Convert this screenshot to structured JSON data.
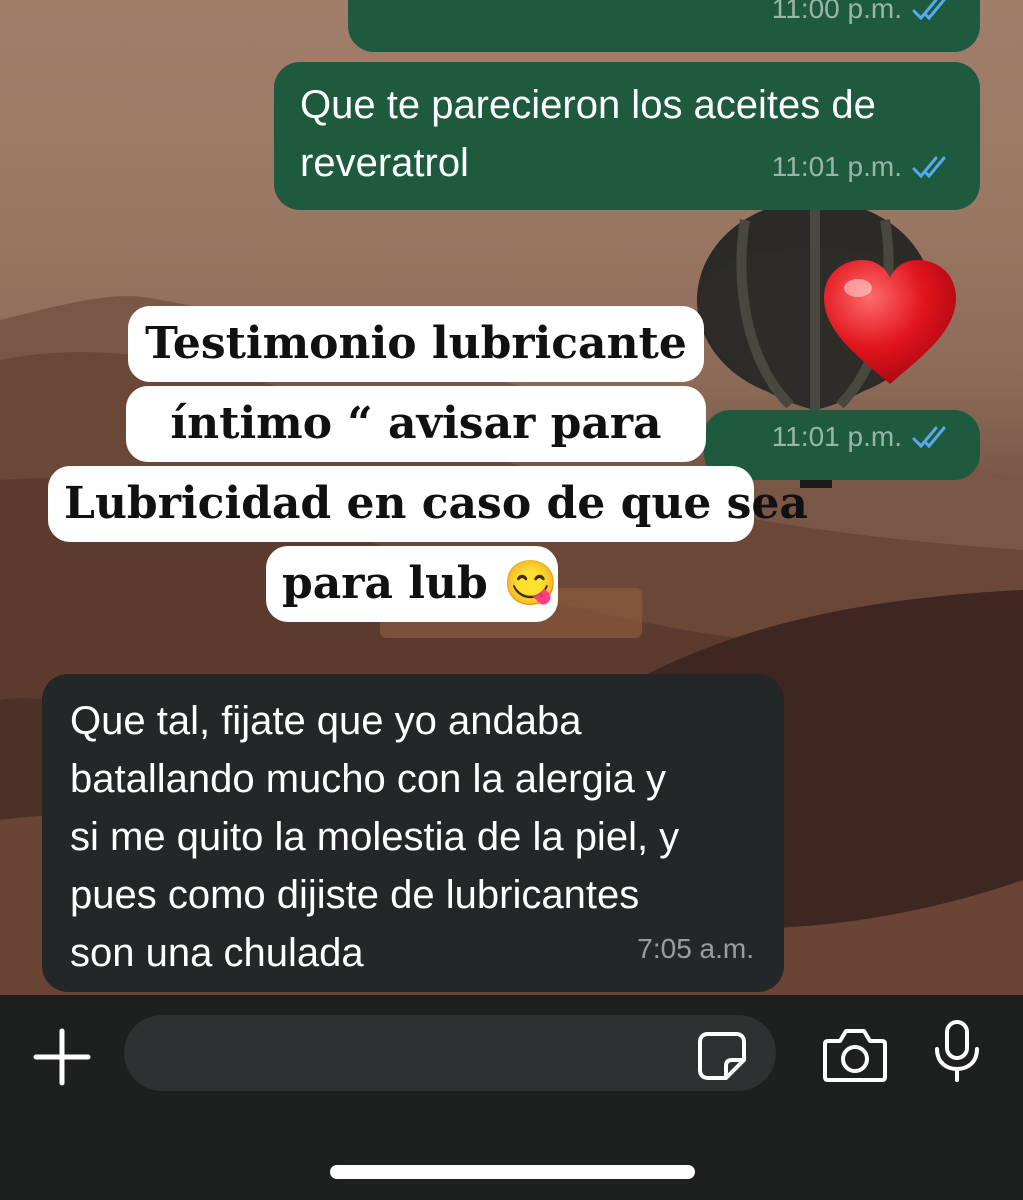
{
  "messages": [
    {
      "id": "m1",
      "direction": "outgoing",
      "text": "",
      "time": "11:00 p.m.",
      "status": "read"
    },
    {
      "id": "m2",
      "direction": "outgoing",
      "text": "Que te parecieron los aceites de\nreveratrol",
      "time": "11:01 p.m.",
      "status": "read"
    },
    {
      "id": "m3",
      "direction": "outgoing",
      "text": "❤️",
      "time": "11:01 p.m.",
      "status": "read"
    },
    {
      "id": "m4",
      "direction": "incoming",
      "text": "Que tal, fijate que yo andaba\nbatallando mucho con la alergia y\nsi me quito la molestia de la piel, y\npues como dijiste de lubricantes\nson una chulada",
      "time": "7:05 a.m."
    }
  ],
  "caption_overlay": {
    "lines": [
      "Testimonio lubricante",
      "íntimo “ avisar para",
      "Lubricidad en caso de que sea",
      "para lub 😋"
    ]
  },
  "input_bar": {
    "placeholder": "",
    "icons": [
      "plus-icon",
      "sticker-icon",
      "camera-icon",
      "microphone-icon"
    ]
  },
  "colors": {
    "outgoing_bubble": "#1e5a3e",
    "incoming_bubble": "#232727",
    "read_ticks": "#5aa9f0",
    "input_bar_bg": "#1e1f1f"
  }
}
